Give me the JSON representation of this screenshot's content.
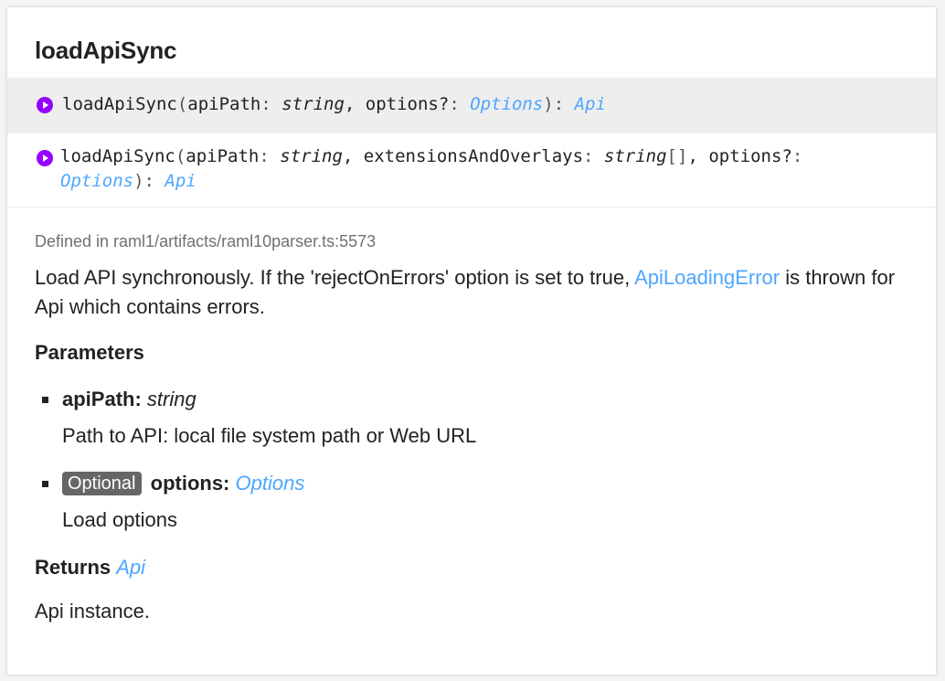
{
  "title": "loadApiSync",
  "signatures": [
    {
      "name": "loadApiSync",
      "open": "(",
      "p1_name": "apiPath",
      "p1_sep": ": ",
      "p1_type": "string",
      "comma": ", ",
      "p2_name": "options?",
      "p2_sep": ": ",
      "p2_type": "Options",
      "close": "): ",
      "ret": "Api"
    },
    {
      "name": "loadApiSync",
      "open": "(",
      "p1_name": "apiPath",
      "p1_sep": ": ",
      "p1_type": "string",
      "comma1": ", ",
      "p2_name": "extensionsAndOverlays",
      "p2_sep": ": ",
      "p2_type": "string",
      "p2_arr": "[]",
      "comma2": ", ",
      "p3_name": "options?",
      "p3_sep": ":",
      "p3_type": "Options",
      "close": "): ",
      "ret": "Api"
    }
  ],
  "defined_in": "Defined in raml1/artifacts/raml10parser.ts:5573",
  "description": {
    "before": "Load API synchronously. If the 'rejectOnErrors' option is set to true, ",
    "link": "ApiLoadingError",
    "after": " is thrown for Api which contains errors."
  },
  "parameters_heading": "Parameters",
  "parameters": [
    {
      "name": "apiPath:",
      "type": "string",
      "description": "Path to API: local file system path or Web URL"
    },
    {
      "badge": "Optional",
      "name": "options:",
      "type": "Options",
      "description": "Load options"
    }
  ],
  "returns_label": "Returns",
  "returns_type": "Api",
  "returns_description": "Api instance.",
  "colors": {
    "link": "#4da6ff",
    "icon": "#9600ff",
    "badge": "#666666"
  }
}
